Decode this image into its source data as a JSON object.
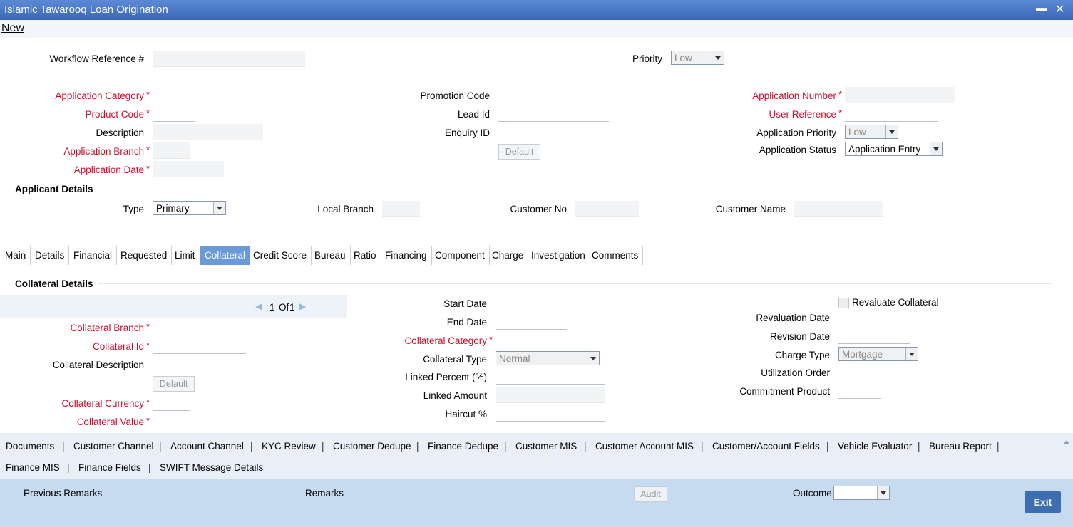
{
  "window": {
    "title": "Islamic Tawarooq Loan Origination",
    "minimize": "▬",
    "close": "✕"
  },
  "menu": {
    "new": "New"
  },
  "workflow": {
    "label": "Workflow Reference #",
    "value": ""
  },
  "priority": {
    "label": "Priority",
    "value": "Low"
  },
  "left_fields": {
    "application_category": "Application Category",
    "product_code": "Product Code",
    "description": "Description",
    "application_branch": "Application Branch",
    "application_date": "Application Date"
  },
  "mid_fields": {
    "promotion_code": "Promotion Code",
    "lead_id": "Lead Id",
    "enquiry_id": "Enquiry ID",
    "default_btn": "Default"
  },
  "right_fields": {
    "application_number": "Application Number",
    "user_reference": "User Reference",
    "application_priority": "Application Priority",
    "application_priority_value": "Low",
    "application_status": "Application Status",
    "application_status_value": "Application Entry"
  },
  "applicant": {
    "title": "Applicant Details",
    "type_label": "Type",
    "type_value": "Primary",
    "local_branch": "Local Branch",
    "customer_no": "Customer No",
    "customer_name": "Customer Name"
  },
  "tabs": [
    "Main",
    "Details",
    "Financial",
    "Requested",
    "Limit",
    "Collateral",
    "Credit Score",
    "Bureau",
    "Ratio",
    "Financing",
    "Component",
    "Charge",
    "Investigation",
    "Comments"
  ],
  "active_tab": "Collateral",
  "collateral": {
    "title": "Collateral Details",
    "pager_current": "1",
    "pager_of": "Of",
    "pager_total": "1",
    "branch": "Collateral Branch",
    "id": "Collateral Id",
    "description": "Collateral Description",
    "default_btn": "Default",
    "currency": "Collateral Currency",
    "value": "Collateral Value",
    "start_date": "Start Date",
    "end_date": "End Date",
    "category": "Collateral Category",
    "type": "Collateral Type",
    "type_value": "Normal",
    "linked_percent": "Linked Percent (%)",
    "linked_amount": "Linked Amount",
    "haircut": "Haircut %",
    "revaluate": "Revaluate Collateral",
    "revaluation_date": "Revaluation Date",
    "revision_date": "Revision Date",
    "charge_type": "Charge Type",
    "charge_type_value": "Mortgage",
    "utilization_order": "Utilization Order",
    "commitment_product": "Commitment Product"
  },
  "links_row1": [
    "Documents",
    "Customer Channel",
    "Account Channel",
    "KYC Review",
    "Customer Dedupe",
    "Finance Dedupe",
    "Customer MIS",
    "Customer Account MIS",
    "Customer/Account Fields",
    "Vehicle Evaluator",
    "Bureau Report"
  ],
  "links_row2": [
    "Finance MIS",
    "Finance Fields",
    "SWIFT Message Details"
  ],
  "link_sep": "|",
  "footer": {
    "previous_remarks": "Previous Remarks",
    "remarks": "Remarks",
    "audit": "Audit",
    "outcome": "Outcome",
    "exit": "Exit"
  },
  "colors": {
    "title_bar": "#3a67b6",
    "required": "#c8102e",
    "active_tab": "#6a9bd8",
    "footer": "#c7dbf0",
    "exit_button": "#3d6fb0"
  }
}
